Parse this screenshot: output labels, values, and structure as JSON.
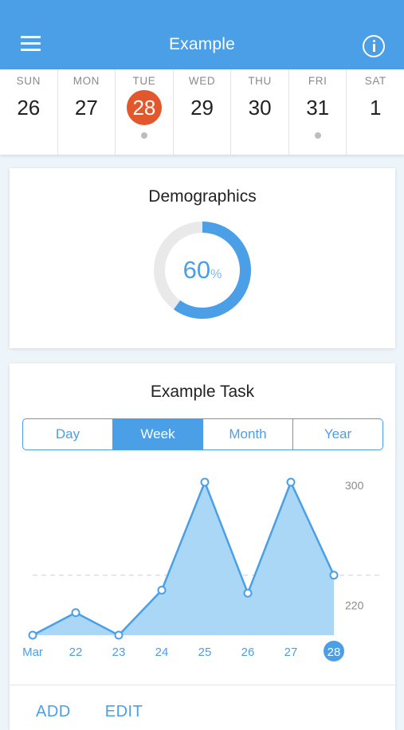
{
  "header": {
    "title": "Example",
    "menu_icon": "menu-icon",
    "info_icon": "info-icon"
  },
  "week": {
    "days": [
      {
        "name": "SUN",
        "num": "26"
      },
      {
        "name": "MON",
        "num": "27"
      },
      {
        "name": "TUE",
        "num": "28"
      },
      {
        "name": "WED",
        "num": "29"
      },
      {
        "name": "THU",
        "num": "30"
      },
      {
        "name": "FRI",
        "num": "31"
      },
      {
        "name": "SAT",
        "num": "1"
      }
    ],
    "selected_index": 2,
    "event_indices": [
      2,
      5
    ]
  },
  "demographics": {
    "title": "Demographics",
    "value": "60",
    "unit": "%",
    "fraction": 0.6
  },
  "task": {
    "title": "Example Task",
    "segments": [
      "Day",
      "Week",
      "Month",
      "Year"
    ],
    "active_segment": "Week",
    "actions": {
      "add": "ADD",
      "edit": "EDIT"
    }
  },
  "colors": {
    "primary": "#4a9fe6",
    "accent": "#e2572b",
    "area": "#a9d7f5"
  },
  "chart_data": {
    "type": "area",
    "categories": [
      "Mar",
      "22",
      "23",
      "24",
      "25",
      "26",
      "27",
      "28"
    ],
    "values": [
      200,
      215,
      200,
      230,
      302,
      228,
      302,
      240
    ],
    "yticks": [
      220,
      300
    ],
    "reference_line": 240,
    "ylim": [
      200,
      302
    ],
    "highlighted_category": "28"
  }
}
